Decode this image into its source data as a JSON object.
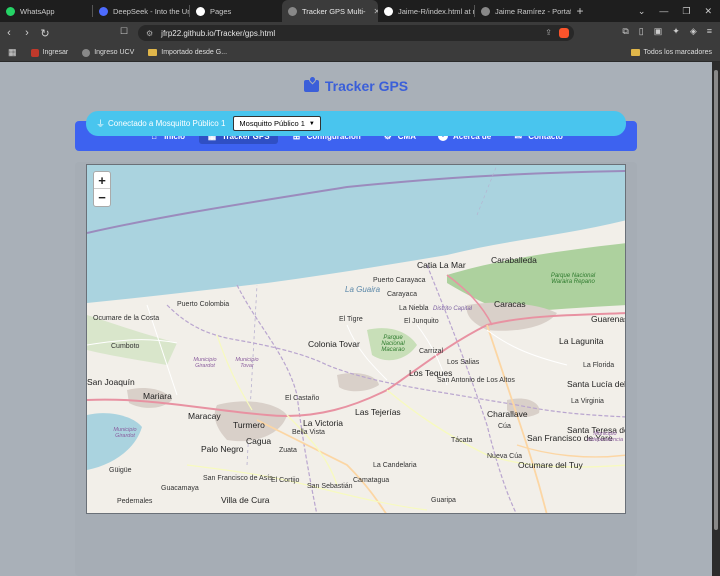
{
  "browser": {
    "tabs": [
      {
        "title": "WhatsApp",
        "favicon_color": "#25d366",
        "active": false
      },
      {
        "title": "DeepSeek - Into the Unk",
        "favicon_color": "#4d6bfe",
        "active": false
      },
      {
        "title": "Pages",
        "favicon_color": "#ffffff",
        "active": false
      },
      {
        "title": "Tracker GPS Multi-",
        "favicon_color": "#888888",
        "active": true
      },
      {
        "title": "Jaime-R/index.html at m",
        "favicon_color": "#ffffff",
        "active": false
      },
      {
        "title": "Jaime Ramírez - Portafol",
        "favicon_color": "#888888",
        "active": false
      }
    ],
    "url": "jfrp22.github.io/Tracker/gps.html",
    "bookmarks": [
      {
        "label": "Ingresar",
        "color": "#c0392b"
      },
      {
        "label": "Ingreso UCV",
        "color": "#888888"
      },
      {
        "label": "Importado desde G...",
        "color": "#e0b64a"
      }
    ],
    "bookmarks_right": "Todos los marcadores"
  },
  "site": {
    "title": "Tracker GPS",
    "brand_color": "#3b5fd9",
    "nav": [
      {
        "label": "Inicio",
        "icon": "home-icon",
        "active": false
      },
      {
        "label": "Tracker GPS",
        "icon": "map-icon",
        "active": true
      },
      {
        "label": "Configuración",
        "icon": "sitemap-icon",
        "active": false
      },
      {
        "label": "CMA",
        "icon": "gear-icon",
        "active": false
      },
      {
        "label": "Acerca de",
        "icon": "info-icon",
        "active": false
      },
      {
        "label": "Contacto",
        "icon": "envelope-icon",
        "active": false
      }
    ],
    "connection": {
      "status": "Conectado a Mosquitto Público 1",
      "selected": "Mosquitto Público 1"
    }
  },
  "map": {
    "zoom_in": "+",
    "zoom_out": "−",
    "sea_label": "La Guaira",
    "cities": [
      {
        "name": "Catia La Mar",
        "big": true
      },
      {
        "name": "Caraballeda",
        "big": true
      },
      {
        "name": "Caracas",
        "big": true
      },
      {
        "name": "Guarenas",
        "big": true
      },
      {
        "name": "Colonia Tovar",
        "big": true
      },
      {
        "name": "La Lagunita",
        "big": true
      },
      {
        "name": "Los Teques",
        "big": true
      },
      {
        "name": "Santa Lucía del Tuy",
        "big": true
      },
      {
        "name": "San Joaquín",
        "big": true
      },
      {
        "name": "Mariara",
        "big": true
      },
      {
        "name": "Maracay",
        "big": true
      },
      {
        "name": "Turmero",
        "big": true
      },
      {
        "name": "La Victoria",
        "big": true
      },
      {
        "name": "Las Tejerías",
        "big": true
      },
      {
        "name": "Charallave",
        "big": true
      },
      {
        "name": "Palo Negro",
        "big": true
      },
      {
        "name": "Cagua",
        "big": true
      },
      {
        "name": "San Francisco de Yare",
        "big": true
      },
      {
        "name": "Ocumare del Tuy",
        "big": true
      },
      {
        "name": "Santa Teresa del Tuy",
        "big": true
      },
      {
        "name": "Villa de Cura",
        "big": true
      },
      {
        "name": "Puerto Carayaca",
        "big": false
      },
      {
        "name": "Carayaca",
        "big": false
      },
      {
        "name": "Puerto Colombia",
        "big": false
      },
      {
        "name": "Ocumare de la Costa",
        "big": false
      },
      {
        "name": "Cumboto",
        "big": false
      },
      {
        "name": "El Tigre",
        "big": false
      },
      {
        "name": "La Niebla",
        "big": false
      },
      {
        "name": "El Junquito",
        "big": false
      },
      {
        "name": "Distrito Capital",
        "big": false
      },
      {
        "name": "Carrizal",
        "big": false
      },
      {
        "name": "Los Salias",
        "big": false
      },
      {
        "name": "San Antonio de Los Altos",
        "big": false
      },
      {
        "name": "La Florida",
        "big": false
      },
      {
        "name": "La Virginia",
        "big": false
      },
      {
        "name": "Tácata",
        "big": false
      },
      {
        "name": "Cúa",
        "big": false
      },
      {
        "name": "San Sebastián",
        "big": false
      },
      {
        "name": "Camatagua",
        "big": false
      },
      {
        "name": "Güigüe",
        "big": false
      },
      {
        "name": "Guacamaya",
        "big": false
      },
      {
        "name": "Pedernales",
        "big": false
      },
      {
        "name": "Guaripa",
        "big": false
      },
      {
        "name": "El Cortijo",
        "big": false
      },
      {
        "name": "La Candelaria",
        "big": false
      },
      {
        "name": "Zuata",
        "big": false
      },
      {
        "name": "Bella Vista",
        "big": false
      },
      {
        "name": "El Castaño",
        "big": false
      },
      {
        "name": "San Francisco de Asís",
        "big": false
      },
      {
        "name": "Nueva Cúa",
        "big": false
      }
    ],
    "parks": [
      "Parque Nacional Waraira Repano",
      "Parque Nacional Macarao"
    ],
    "municipios": [
      "Municipio Girardot",
      "Municipio Tovar",
      "Municipio Independencia",
      "Municipio Girardot"
    ]
  }
}
